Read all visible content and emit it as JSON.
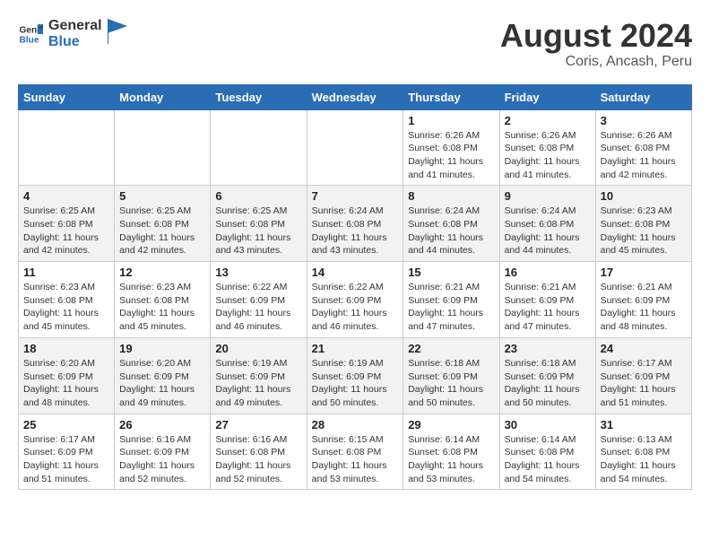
{
  "header": {
    "logo_general": "General",
    "logo_blue": "Blue",
    "main_title": "August 2024",
    "sub_title": "Coris, Ancash, Peru"
  },
  "weekdays": [
    "Sunday",
    "Monday",
    "Tuesday",
    "Wednesday",
    "Thursday",
    "Friday",
    "Saturday"
  ],
  "weeks": [
    [
      {
        "day": "",
        "detail": ""
      },
      {
        "day": "",
        "detail": ""
      },
      {
        "day": "",
        "detail": ""
      },
      {
        "day": "",
        "detail": ""
      },
      {
        "day": "1",
        "detail": "Sunrise: 6:26 AM\nSunset: 6:08 PM\nDaylight: 11 hours and 41 minutes."
      },
      {
        "day": "2",
        "detail": "Sunrise: 6:26 AM\nSunset: 6:08 PM\nDaylight: 11 hours and 41 minutes."
      },
      {
        "day": "3",
        "detail": "Sunrise: 6:26 AM\nSunset: 6:08 PM\nDaylight: 11 hours and 42 minutes."
      }
    ],
    [
      {
        "day": "4",
        "detail": "Sunrise: 6:25 AM\nSunset: 6:08 PM\nDaylight: 11 hours and 42 minutes."
      },
      {
        "day": "5",
        "detail": "Sunrise: 6:25 AM\nSunset: 6:08 PM\nDaylight: 11 hours and 42 minutes."
      },
      {
        "day": "6",
        "detail": "Sunrise: 6:25 AM\nSunset: 6:08 PM\nDaylight: 11 hours and 43 minutes."
      },
      {
        "day": "7",
        "detail": "Sunrise: 6:24 AM\nSunset: 6:08 PM\nDaylight: 11 hours and 43 minutes."
      },
      {
        "day": "8",
        "detail": "Sunrise: 6:24 AM\nSunset: 6:08 PM\nDaylight: 11 hours and 44 minutes."
      },
      {
        "day": "9",
        "detail": "Sunrise: 6:24 AM\nSunset: 6:08 PM\nDaylight: 11 hours and 44 minutes."
      },
      {
        "day": "10",
        "detail": "Sunrise: 6:23 AM\nSunset: 6:08 PM\nDaylight: 11 hours and 45 minutes."
      }
    ],
    [
      {
        "day": "11",
        "detail": "Sunrise: 6:23 AM\nSunset: 6:08 PM\nDaylight: 11 hours and 45 minutes."
      },
      {
        "day": "12",
        "detail": "Sunrise: 6:23 AM\nSunset: 6:08 PM\nDaylight: 11 hours and 45 minutes."
      },
      {
        "day": "13",
        "detail": "Sunrise: 6:22 AM\nSunset: 6:09 PM\nDaylight: 11 hours and 46 minutes."
      },
      {
        "day": "14",
        "detail": "Sunrise: 6:22 AM\nSunset: 6:09 PM\nDaylight: 11 hours and 46 minutes."
      },
      {
        "day": "15",
        "detail": "Sunrise: 6:21 AM\nSunset: 6:09 PM\nDaylight: 11 hours and 47 minutes."
      },
      {
        "day": "16",
        "detail": "Sunrise: 6:21 AM\nSunset: 6:09 PM\nDaylight: 11 hours and 47 minutes."
      },
      {
        "day": "17",
        "detail": "Sunrise: 6:21 AM\nSunset: 6:09 PM\nDaylight: 11 hours and 48 minutes."
      }
    ],
    [
      {
        "day": "18",
        "detail": "Sunrise: 6:20 AM\nSunset: 6:09 PM\nDaylight: 11 hours and 48 minutes."
      },
      {
        "day": "19",
        "detail": "Sunrise: 6:20 AM\nSunset: 6:09 PM\nDaylight: 11 hours and 49 minutes."
      },
      {
        "day": "20",
        "detail": "Sunrise: 6:19 AM\nSunset: 6:09 PM\nDaylight: 11 hours and 49 minutes."
      },
      {
        "day": "21",
        "detail": "Sunrise: 6:19 AM\nSunset: 6:09 PM\nDaylight: 11 hours and 50 minutes."
      },
      {
        "day": "22",
        "detail": "Sunrise: 6:18 AM\nSunset: 6:09 PM\nDaylight: 11 hours and 50 minutes."
      },
      {
        "day": "23",
        "detail": "Sunrise: 6:18 AM\nSunset: 6:09 PM\nDaylight: 11 hours and 50 minutes."
      },
      {
        "day": "24",
        "detail": "Sunrise: 6:17 AM\nSunset: 6:09 PM\nDaylight: 11 hours and 51 minutes."
      }
    ],
    [
      {
        "day": "25",
        "detail": "Sunrise: 6:17 AM\nSunset: 6:09 PM\nDaylight: 11 hours and 51 minutes."
      },
      {
        "day": "26",
        "detail": "Sunrise: 6:16 AM\nSunset: 6:09 PM\nDaylight: 11 hours and 52 minutes."
      },
      {
        "day": "27",
        "detail": "Sunrise: 6:16 AM\nSunset: 6:08 PM\nDaylight: 11 hours and 52 minutes."
      },
      {
        "day": "28",
        "detail": "Sunrise: 6:15 AM\nSunset: 6:08 PM\nDaylight: 11 hours and 53 minutes."
      },
      {
        "day": "29",
        "detail": "Sunrise: 6:14 AM\nSunset: 6:08 PM\nDaylight: 11 hours and 53 minutes."
      },
      {
        "day": "30",
        "detail": "Sunrise: 6:14 AM\nSunset: 6:08 PM\nDaylight: 11 hours and 54 minutes."
      },
      {
        "day": "31",
        "detail": "Sunrise: 6:13 AM\nSunset: 6:08 PM\nDaylight: 11 hours and 54 minutes."
      }
    ]
  ]
}
